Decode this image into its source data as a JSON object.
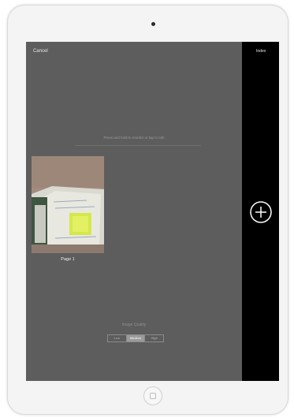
{
  "header": {
    "cancel_label": "Cancel",
    "index_label": "Index"
  },
  "main": {
    "hint": "Press and hold to reorder or tap to edit",
    "pages": [
      {
        "label": "Page 1"
      }
    ],
    "quality": {
      "label": "Image Quality",
      "options": [
        "Low",
        "Medium",
        "High"
      ],
      "selected": "Medium"
    }
  },
  "sidebar": {
    "add_icon": "plus-circle-icon"
  },
  "colors": {
    "screen_bg": "#5d5d5d",
    "side_panel_bg": "#000000",
    "device_frame": "#f4f4f4"
  }
}
